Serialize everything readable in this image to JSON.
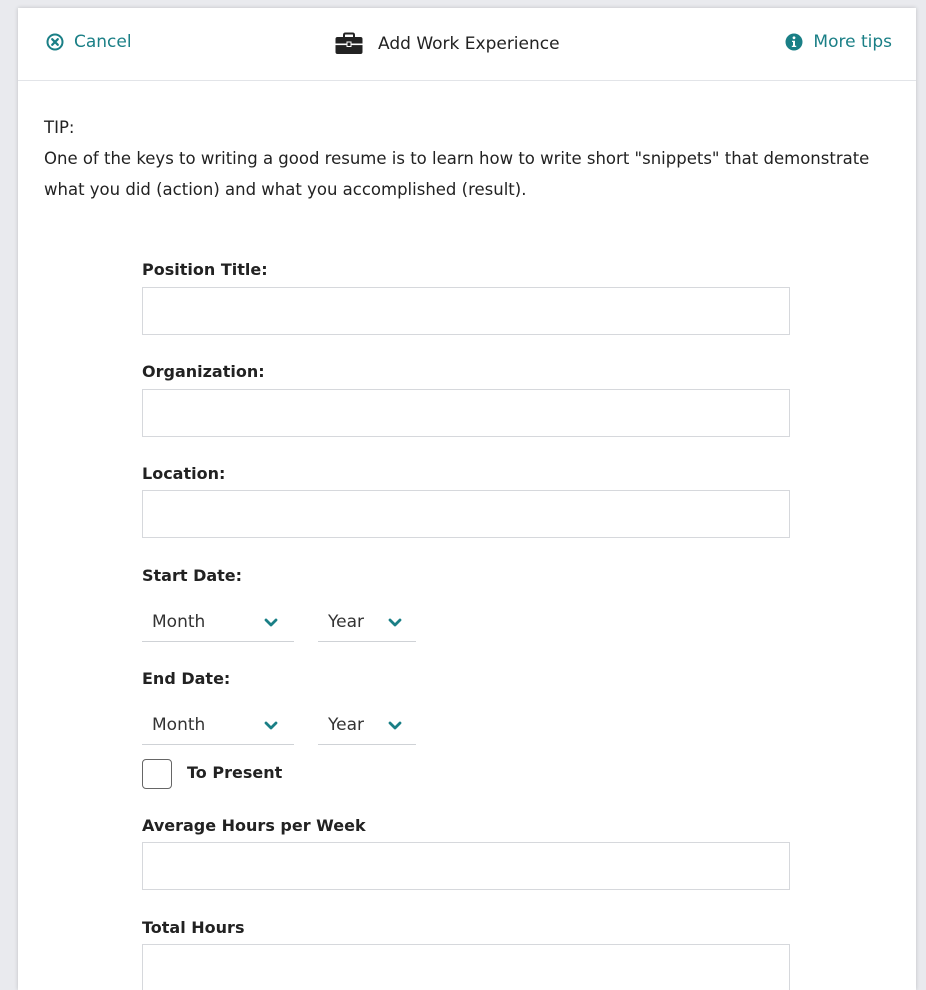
{
  "header": {
    "cancel_label": "Cancel",
    "title": "Add Work Experience",
    "tips_label": "More tips"
  },
  "tip": {
    "heading": "TIP:",
    "text": "One of the keys to writing a good resume is to learn how to write short \"snippets\" that demonstrate what you did (action) and what you accomplished (result)."
  },
  "form": {
    "position_title": {
      "label": "Position Title:",
      "value": ""
    },
    "organization": {
      "label": "Organization:",
      "value": ""
    },
    "location": {
      "label": "Location:",
      "value": ""
    },
    "start_date": {
      "label": "Start Date:",
      "month": "Month",
      "year": "Year"
    },
    "end_date": {
      "label": "End Date:",
      "month": "Month",
      "year": "Year"
    },
    "to_present": {
      "label": "To Present",
      "checked": false
    },
    "avg_hours": {
      "label": "Average Hours per Week",
      "value": ""
    },
    "total_hours": {
      "label": "Total Hours",
      "value": ""
    }
  },
  "colors": {
    "accent": "#1a7f86",
    "text": "#222222",
    "border": "#d6d8dc"
  },
  "icons": {
    "cancel": "close-circle-icon",
    "title": "briefcase-icon",
    "tips": "info-circle-icon",
    "select": "chevron-down-icon"
  }
}
